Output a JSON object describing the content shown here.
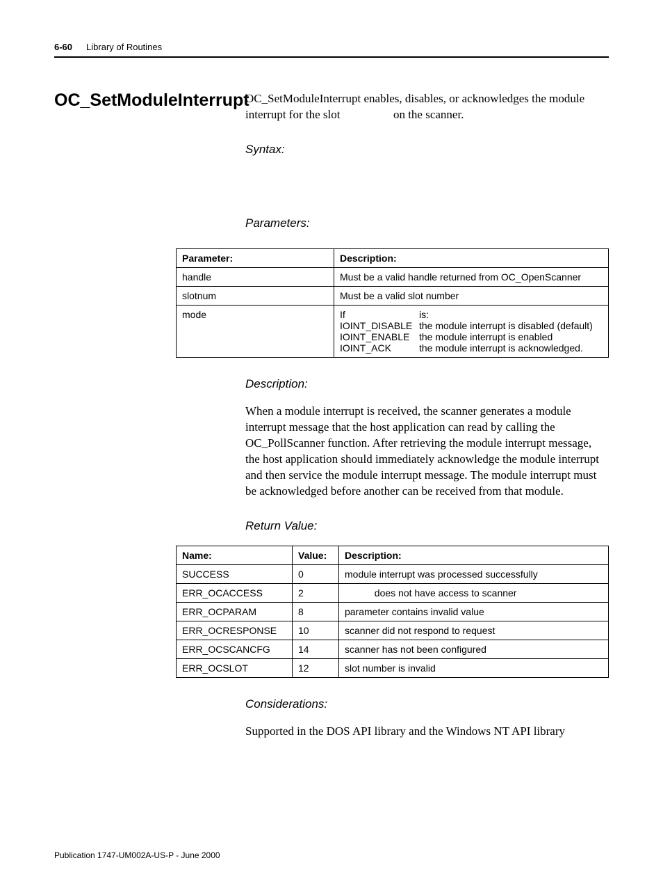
{
  "header": {
    "page_number": "6-60",
    "section": "Library of Routines"
  },
  "function_name": "OC_SetModuleInterrupt",
  "summary": "OC_SetModuleInterrupt enables, disables, or acknowledges the module interrupt for the slot                  on the scanner.",
  "labels": {
    "syntax": "Syntax:",
    "parameters": "Parameters:",
    "description_h": "Description:",
    "return_value": "Return Value:",
    "considerations": "Considerations:"
  },
  "params_table": {
    "header": {
      "col1": "Parameter:",
      "col2": "Description:"
    },
    "rows": [
      {
        "name": "handle",
        "desc": "Must be a valid handle returned from OC_OpenScanner"
      },
      {
        "name": "slotnum",
        "desc": "Must be a valid slot number"
      }
    ],
    "mode_row": {
      "name": "mode",
      "if": "If",
      "is": "is:",
      "codes": [
        "IOINT_DISABLE",
        "IOINT_ENABLE",
        "IOINT_ACK"
      ],
      "effects": [
        "the module interrupt is disabled (default)",
        "the module interrupt is enabled",
        "the module interrupt is acknowledged."
      ]
    }
  },
  "description": "When a module interrupt is received, the scanner generates a module interrupt message that the host application can read by calling the OC_PollScanner function. After retrieving the module interrupt message, the host application should immediately acknowledge the module interrupt and then service the module interrupt message. The module interrupt must be acknowledged before another can be received from that module.",
  "return_table": {
    "header": {
      "col1": "Name:",
      "col2": "Value:",
      "col3": "Description:"
    },
    "rows": [
      {
        "name": "SUCCESS",
        "value": "0",
        "desc": "module interrupt was processed successfully"
      },
      {
        "name": "ERR_OCACCESS",
        "value": "2",
        "desc": "           does not have access to scanner"
      },
      {
        "name": "ERR_OCPARAM",
        "value": "8",
        "desc": "parameter contains invalid value"
      },
      {
        "name": "ERR_OCRESPONSE",
        "value": "10",
        "desc": "scanner did not respond to request"
      },
      {
        "name": "ERR_OCSCANCFG",
        "value": "14",
        "desc": "scanner has not been configured"
      },
      {
        "name": "ERR_OCSLOT",
        "value": "12",
        "desc": "slot number is invalid"
      }
    ]
  },
  "considerations": "Supported in the DOS API library and the Windows NT API library",
  "footer": "Publication 1747-UM002A-US-P - June 2000"
}
